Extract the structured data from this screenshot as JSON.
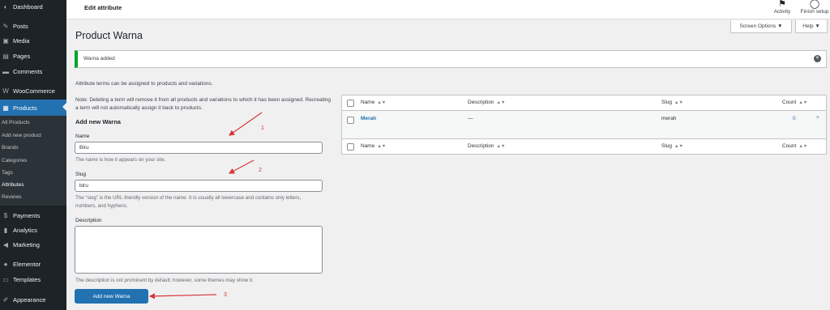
{
  "sidebar": {
    "items": [
      {
        "label": "Dashboard",
        "icon": "dashboard-icon",
        "glyph": "◐"
      },
      {
        "label": "Posts",
        "icon": "pin-icon",
        "glyph": "✎"
      },
      {
        "label": "Media",
        "icon": "media-icon",
        "glyph": "▣"
      },
      {
        "label": "Pages",
        "icon": "pages-icon",
        "glyph": "▤"
      },
      {
        "label": "Comments",
        "icon": "comment-icon",
        "glyph": "▬"
      },
      {
        "label": "WooCommerce",
        "icon": "woo-icon",
        "glyph": "W"
      },
      {
        "label": "Products",
        "icon": "products-icon",
        "glyph": "▦"
      },
      {
        "label": "Payments",
        "icon": "payments-icon",
        "glyph": "$"
      },
      {
        "label": "Analytics",
        "icon": "analytics-icon",
        "glyph": "▮"
      },
      {
        "label": "Marketing",
        "icon": "megaphone-icon",
        "glyph": "◀"
      },
      {
        "label": "Elementor",
        "icon": "elementor-icon",
        "glyph": "●"
      },
      {
        "label": "Templates",
        "icon": "templates-icon",
        "glyph": "▭"
      },
      {
        "label": "Appearance",
        "icon": "appearance-icon",
        "glyph": "✐"
      }
    ],
    "submenu": [
      "All Products",
      "Add new product",
      "Brands",
      "Categories",
      "Tags",
      "Attributes",
      "Reviews"
    ]
  },
  "topbar": {
    "title": "Edit attribute",
    "activity_label": "Activity",
    "activity_icon": "⚑",
    "setup_label": "Finish setup",
    "setup_icon": "◯"
  },
  "screen_options": "Screen Options ▼",
  "help": "Help ▼",
  "page_title": "Product Warna",
  "notice": {
    "text": "Warna added",
    "dismiss_glyph": "✕",
    "color": "#00a32a"
  },
  "notes": {
    "attr_terms": "Attribute terms can be assigned to products and variations.",
    "deleting": "Note: Deleting a term will remove it from all products and variations to which it has been assigned. Recreating a term will not automatically assign it back to products."
  },
  "form": {
    "heading": "Add new Warna",
    "name_label": "Name",
    "name_value": "Biru",
    "name_help": "The name is how it appears on your site.",
    "slug_label": "Slug",
    "slug_value": "biru",
    "slug_help": "The “slug” is the URL-friendly version of the name. It is usually all lowercase and contains only letters, numbers, and hyphens.",
    "desc_label": "Description",
    "desc_value": "",
    "desc_help": "The description is not prominent by default; however, some themes may show it.",
    "submit": "Add new Warna"
  },
  "table": {
    "headers": {
      "name": "Name",
      "description": "Description",
      "slug": "Slug",
      "count": "Count"
    },
    "sort_glyph": "▲▼",
    "rows": [
      {
        "name": "Merah",
        "description": "—",
        "slug": "merah",
        "count": "0",
        "handle": "≡"
      }
    ]
  },
  "annotations": [
    "1",
    "2",
    "3"
  ],
  "colors": {
    "accent": "#2271b1",
    "sidebar": "#1d2327",
    "annotation": "#d63638"
  }
}
